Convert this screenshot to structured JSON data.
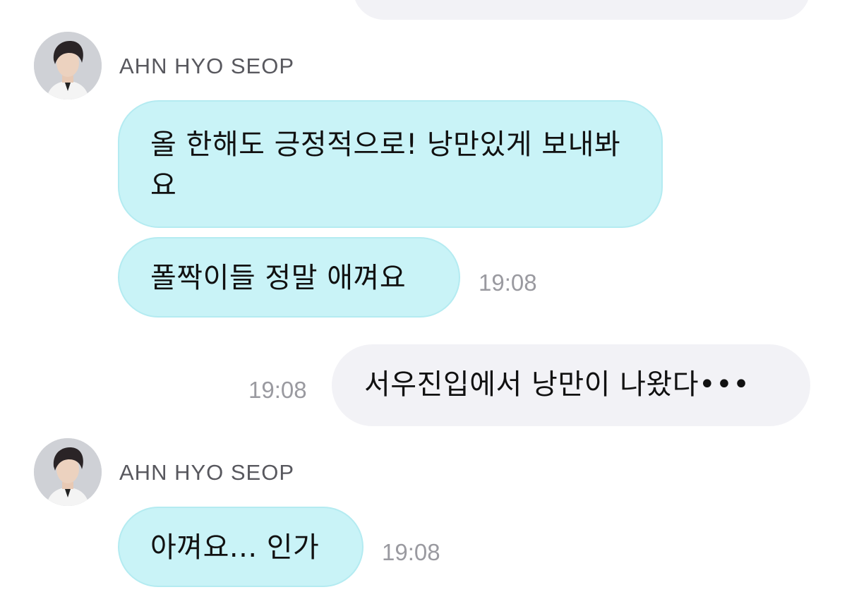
{
  "sender": {
    "name": "AHN HYO SEOP"
  },
  "messages": [
    {
      "text": "올 한해도 긍정적으로! 낭만있게 보내봐요"
    },
    {
      "text": "폴짝이들 정말 애껴요",
      "time": "19:08"
    },
    {
      "text": "서우진입에서 낭만이 나왔다•••",
      "time": "19:08"
    },
    {
      "text": "아껴요... 인가",
      "time": "19:08"
    }
  ]
}
